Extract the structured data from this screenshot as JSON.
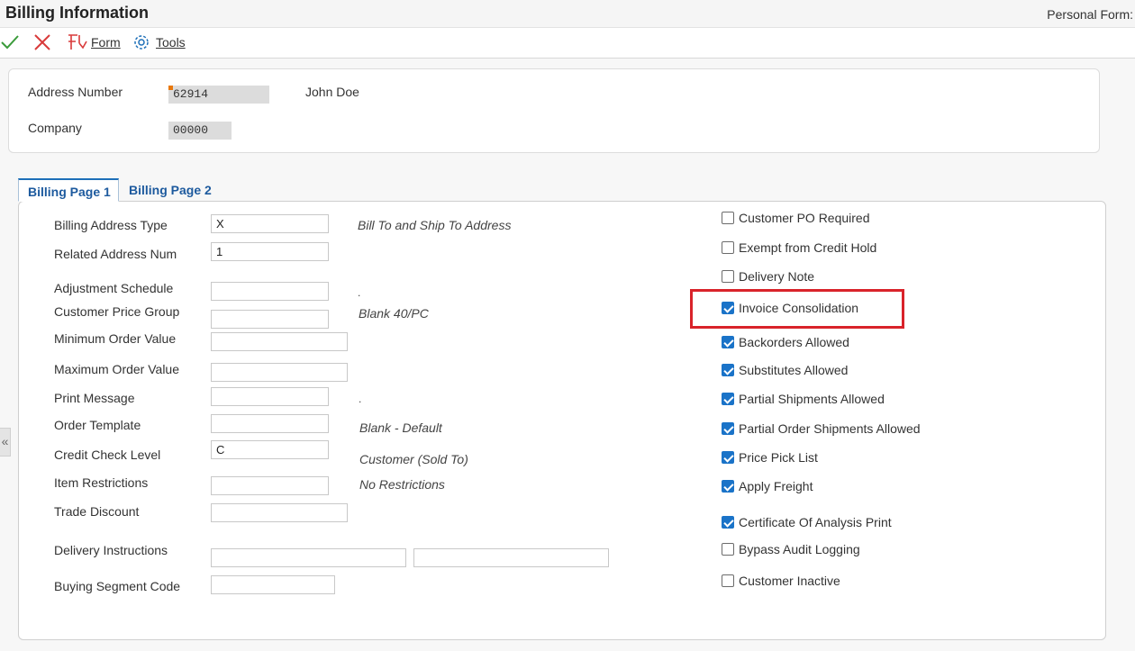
{
  "window": {
    "title": "Billing Information",
    "personal_form": "Personal Form:"
  },
  "toolbar": {
    "form_label": "Form",
    "tools_label": "Tools"
  },
  "header": {
    "address_number_label": "Address Number",
    "address_number_value": "62914",
    "address_name": "John Doe",
    "company_label": "Company",
    "company_value": "00000"
  },
  "tabs": [
    {
      "label": "Billing Page 1",
      "active": true
    },
    {
      "label": "Billing Page 2",
      "active": false
    }
  ],
  "fields": {
    "billing_address_type": {
      "label": "Billing Address Type",
      "value": "X",
      "desc": "Bill To and Ship To Address"
    },
    "related_address_num": {
      "label": "Related Address Num",
      "value": "1"
    },
    "adjustment_schedule": {
      "label": "Adjustment Schedule",
      "value": "",
      "desc": "."
    },
    "customer_price_group": {
      "label": "Customer Price Group",
      "value": "",
      "desc": "Blank 40/PC"
    },
    "minimum_order_value": {
      "label": "Minimum Order Value",
      "value": ""
    },
    "maximum_order_value": {
      "label": "Maximum Order Value",
      "value": ""
    },
    "print_message": {
      "label": "Print Message",
      "value": "",
      "desc": "."
    },
    "order_template": {
      "label": "Order Template",
      "value": "",
      "desc": "Blank - Default"
    },
    "credit_check_level": {
      "label": "Credit Check Level",
      "value": "C",
      "desc": "Customer (Sold To)"
    },
    "item_restrictions": {
      "label": "Item Restrictions",
      "value": "",
      "desc": "No Restrictions"
    },
    "trade_discount": {
      "label": "Trade Discount",
      "value": ""
    },
    "delivery_instructions": {
      "label": "Delivery Instructions",
      "value1": "",
      "value2": ""
    },
    "buying_segment_code": {
      "label": "Buying Segment Code",
      "value": ""
    }
  },
  "checkboxes": [
    {
      "label": "Customer PO Required",
      "checked": false
    },
    {
      "label": "Exempt from Credit Hold",
      "checked": false
    },
    {
      "label": "Delivery Note",
      "checked": false
    },
    {
      "label": "Invoice Consolidation",
      "checked": true
    },
    {
      "label": "Backorders Allowed",
      "checked": true
    },
    {
      "label": "Substitutes Allowed",
      "checked": true
    },
    {
      "label": "Partial Shipments Allowed",
      "checked": true
    },
    {
      "label": "Partial Order Shipments Allowed",
      "checked": true
    },
    {
      "label": "Price Pick List",
      "checked": true
    },
    {
      "label": "Apply Freight",
      "checked": true
    },
    {
      "label": "Certificate Of Analysis Print",
      "checked": true
    },
    {
      "label": "Bypass Audit Logging",
      "checked": false
    },
    {
      "label": "Customer Inactive",
      "checked": false
    }
  ],
  "colors": {
    "accent": "#1d6fb8",
    "highlight": "#d9232a",
    "ok_icon": "#3a9b3a",
    "cancel_icon": "#d93a3a"
  }
}
